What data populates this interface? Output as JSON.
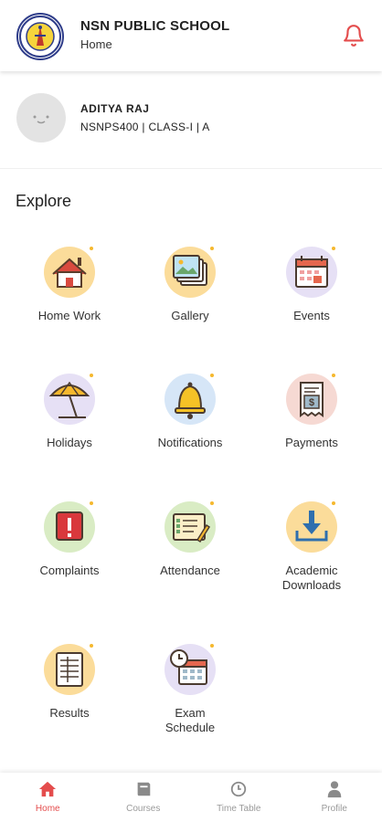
{
  "header": {
    "school_name": "NSN PUBLIC SCHOOL",
    "screen_name": "Home"
  },
  "student": {
    "name": "ADITYA RAJ",
    "meta": "NSNPS400 | CLASS-I | A"
  },
  "explore": {
    "title": "Explore",
    "items": [
      {
        "label": "Home Work",
        "icon": "home-icon"
      },
      {
        "label": "Gallery",
        "icon": "gallery-icon"
      },
      {
        "label": "Events",
        "icon": "calendar-icon"
      },
      {
        "label": "Holidays",
        "icon": "umbrella-icon"
      },
      {
        "label": "Notifications",
        "icon": "bell-icon"
      },
      {
        "label": "Payments",
        "icon": "receipt-icon"
      },
      {
        "label": "Complaints",
        "icon": "alert-icon"
      },
      {
        "label": "Attendance",
        "icon": "checklist-icon"
      },
      {
        "label": "Academic\nDownloads",
        "label_line1": "Academic",
        "label_line2": "Downloads",
        "icon": "download-icon"
      },
      {
        "label": "Results",
        "icon": "results-icon"
      },
      {
        "label": "Exam Schedule",
        "label_line1": "Exam",
        "label_line2": "Schedule",
        "icon": "clock-calendar-icon"
      }
    ]
  },
  "bottom_nav": {
    "items": [
      {
        "label": "Home",
        "icon": "home-icon",
        "active": true
      },
      {
        "label": "Courses",
        "icon": "book-icon",
        "active": false
      },
      {
        "label": "Time Table",
        "icon": "clock-icon",
        "active": false
      },
      {
        "label": "Profile",
        "icon": "person-icon",
        "active": false
      }
    ]
  },
  "colors": {
    "accent": "#e44d4d",
    "nav_inactive": "#9a9a9a",
    "logo_ring": "#2f3d8a"
  }
}
